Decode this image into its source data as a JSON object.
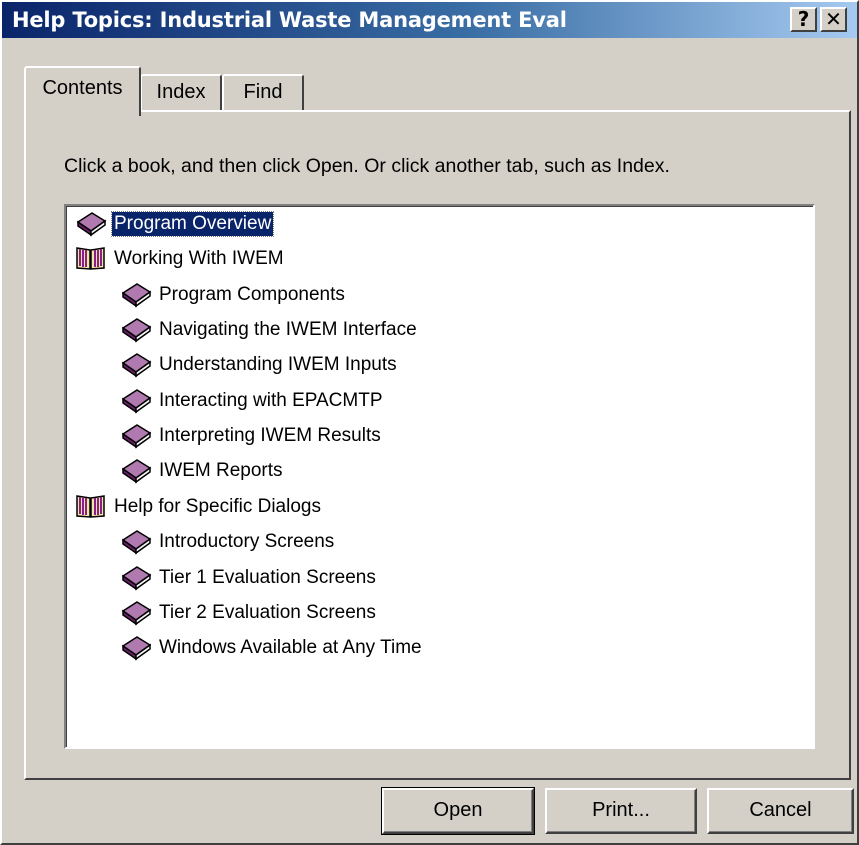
{
  "window": {
    "title": "Help Topics: Industrial Waste Management Eval",
    "help_glyph": "?",
    "close_glyph": "✕"
  },
  "tabs": [
    {
      "label": "Contents",
      "active": true
    },
    {
      "label": "Index",
      "active": false
    },
    {
      "label": "Find",
      "active": false
    }
  ],
  "instructions": "Click a book, and then click Open. Or click another tab, such as Index.",
  "tree": {
    "items": [
      {
        "label": "Program Overview",
        "icon": "closed-book-icon",
        "level": 0,
        "selected": true
      },
      {
        "label": "Working With IWEM",
        "icon": "open-book-icon",
        "level": 0,
        "selected": false
      },
      {
        "label": "Program Components",
        "icon": "closed-book-icon",
        "level": 1,
        "selected": false
      },
      {
        "label": "Navigating the IWEM Interface",
        "icon": "closed-book-icon",
        "level": 1,
        "selected": false
      },
      {
        "label": "Understanding IWEM Inputs",
        "icon": "closed-book-icon",
        "level": 1,
        "selected": false
      },
      {
        "label": "Interacting with EPACMTP",
        "icon": "closed-book-icon",
        "level": 1,
        "selected": false
      },
      {
        "label": "Interpreting IWEM Results",
        "icon": "closed-book-icon",
        "level": 1,
        "selected": false
      },
      {
        "label": "IWEM Reports",
        "icon": "closed-book-icon",
        "level": 1,
        "selected": false
      },
      {
        "label": "Help for Specific Dialogs",
        "icon": "open-book-icon",
        "level": 0,
        "selected": false
      },
      {
        "label": "Introductory Screens",
        "icon": "closed-book-icon",
        "level": 1,
        "selected": false
      },
      {
        "label": "Tier 1 Evaluation Screens",
        "icon": "closed-book-icon",
        "level": 1,
        "selected": false
      },
      {
        "label": "Tier 2 Evaluation Screens",
        "icon": "closed-book-icon",
        "level": 1,
        "selected": false
      },
      {
        "label": "Windows Available at Any Time",
        "icon": "closed-book-icon",
        "level": 1,
        "selected": false
      }
    ]
  },
  "buttons": {
    "open": "Open",
    "print": "Print...",
    "cancel": "Cancel"
  },
  "colors": {
    "titlebar_start": "#0a246a",
    "titlebar_end": "#a6caf0",
    "dialog_face": "#d4d0c8",
    "selection": "#0a246a",
    "book": "#7a2a7a"
  }
}
